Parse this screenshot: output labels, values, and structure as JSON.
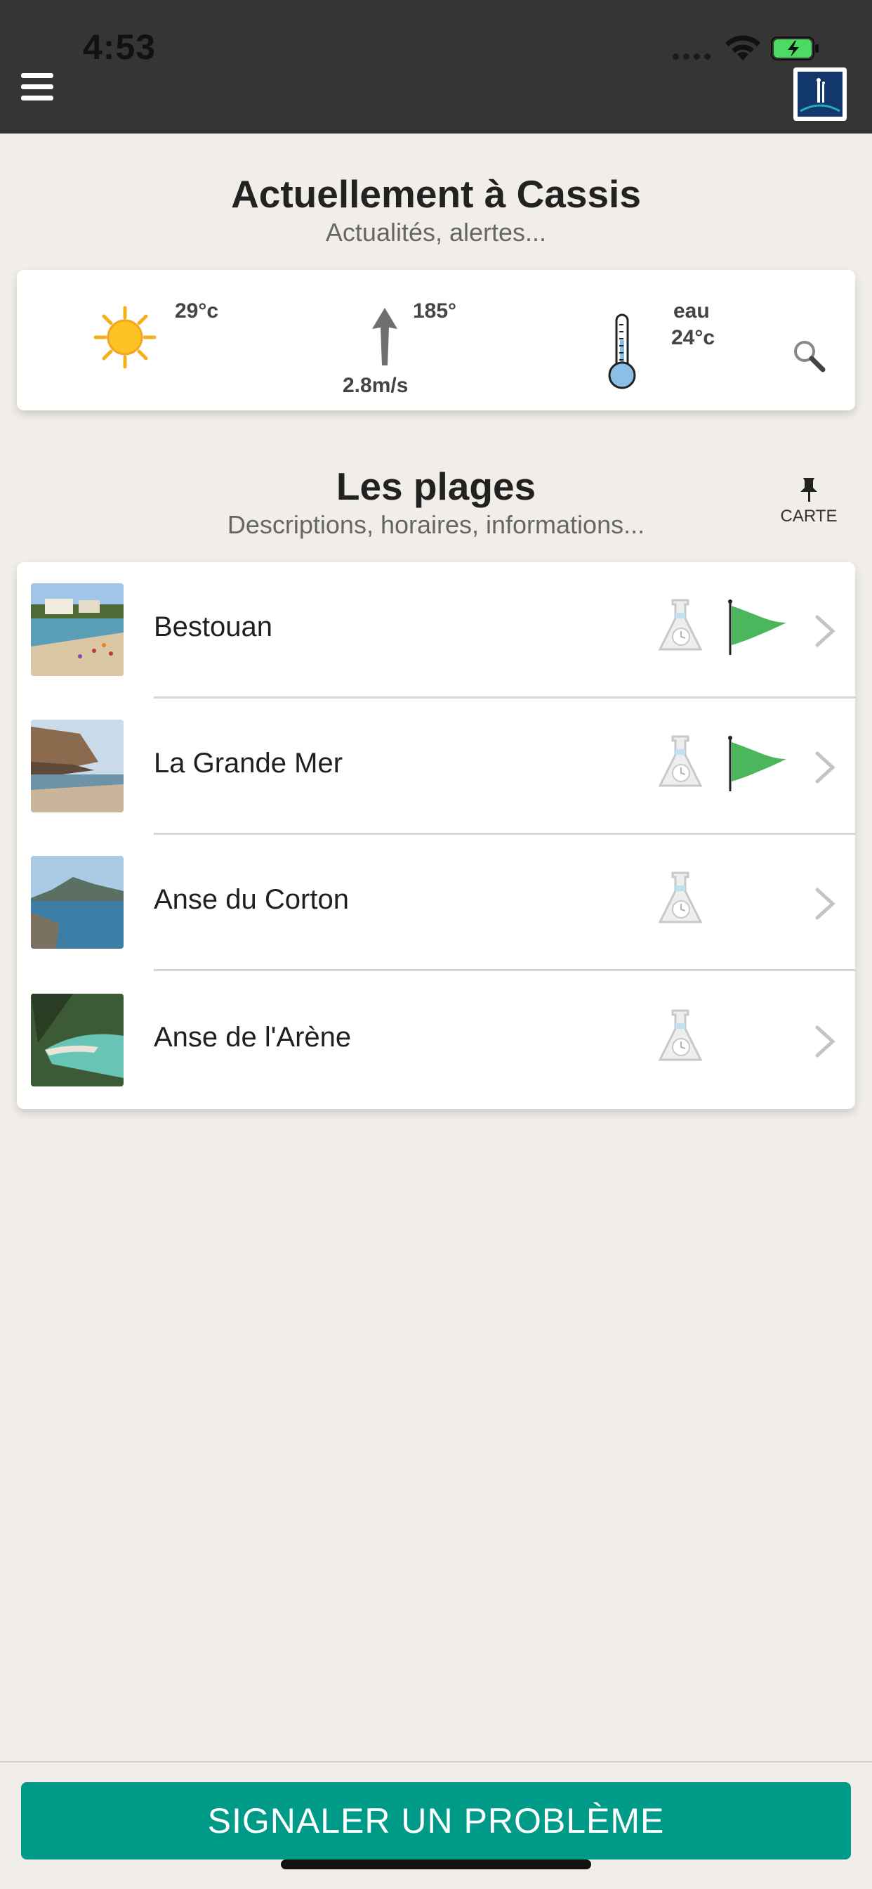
{
  "status_bar": {
    "time": "4:53"
  },
  "header": {
    "menu_icon": "hamburger-icon",
    "logo": "cassis-logo"
  },
  "current": {
    "title": "Actuellement à Cassis",
    "subtitle": "Actualités, alertes...",
    "weather": {
      "air_temp": "29°c",
      "wind_direction": "185°",
      "wind_speed": "2.8m/s",
      "water_label": "eau",
      "water_temp": "24°c"
    }
  },
  "beaches": {
    "title": "Les plages",
    "subtitle": "Descriptions, horaires, informations...",
    "map_button_label": "CARTE",
    "items": [
      {
        "name": "Bestouan",
        "flag": "green"
      },
      {
        "name": "La Grande Mer",
        "flag": "green"
      },
      {
        "name": "Anse du Corton",
        "flag": ""
      },
      {
        "name": "Anse de l'Arène",
        "flag": ""
      }
    ]
  },
  "report_button": {
    "label": "SIGNALER UN PROBLÈME"
  },
  "colors": {
    "header_bg": "#353535",
    "page_bg": "#f1eee9",
    "accent": "#009a88",
    "flag_green": "#4cb65c"
  }
}
